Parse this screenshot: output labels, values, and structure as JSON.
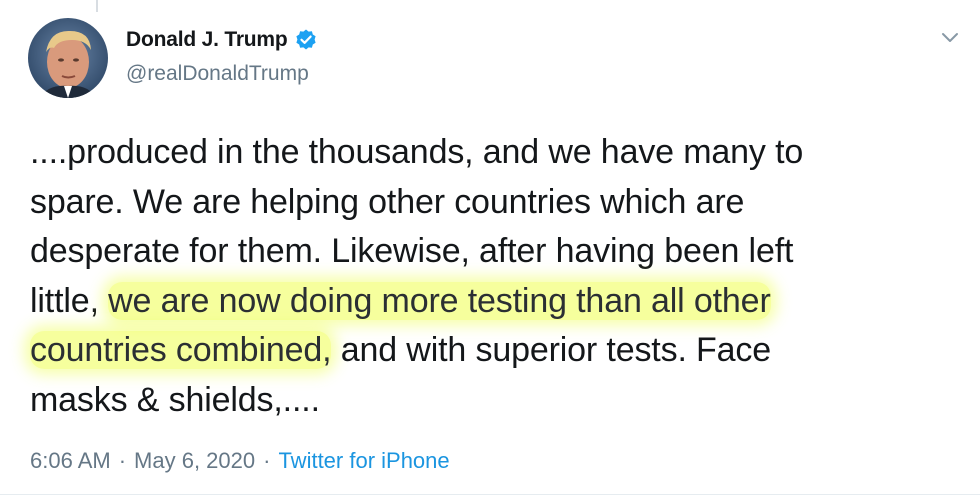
{
  "author": {
    "display_name": "Donald J. Trump",
    "handle": "@realDonaldTrump",
    "verified": true,
    "avatar_icon": "user-avatar-icon"
  },
  "tweet": {
    "lines": [
      {
        "before": "....produced in the thousands, and we have many to",
        "highlight": "",
        "after": ""
      },
      {
        "before": "spare. We are helping other countries which are",
        "highlight": "",
        "after": ""
      },
      {
        "before": "desperate for them. Likewise, after having been left",
        "highlight": "",
        "after": ""
      },
      {
        "before": "little, ",
        "highlight": "we are now doing more testing than all other",
        "after": ""
      },
      {
        "before": "",
        "highlight": "countries combined,",
        "after": " and with superior tests. Face"
      },
      {
        "before": "masks & shields,....",
        "highlight": "",
        "after": ""
      }
    ],
    "highlight_color": "#eeff4c"
  },
  "meta": {
    "time": "6:06 AM",
    "separator": "·",
    "date": "May 6, 2020",
    "source": "Twitter for iPhone"
  },
  "icons": {
    "verified": "verified-badge-icon",
    "menu": "chevron-down-icon"
  },
  "colors": {
    "text": "#14171a",
    "secondary": "#657786",
    "link": "#1b95e0",
    "verified": "#1da1f2"
  }
}
